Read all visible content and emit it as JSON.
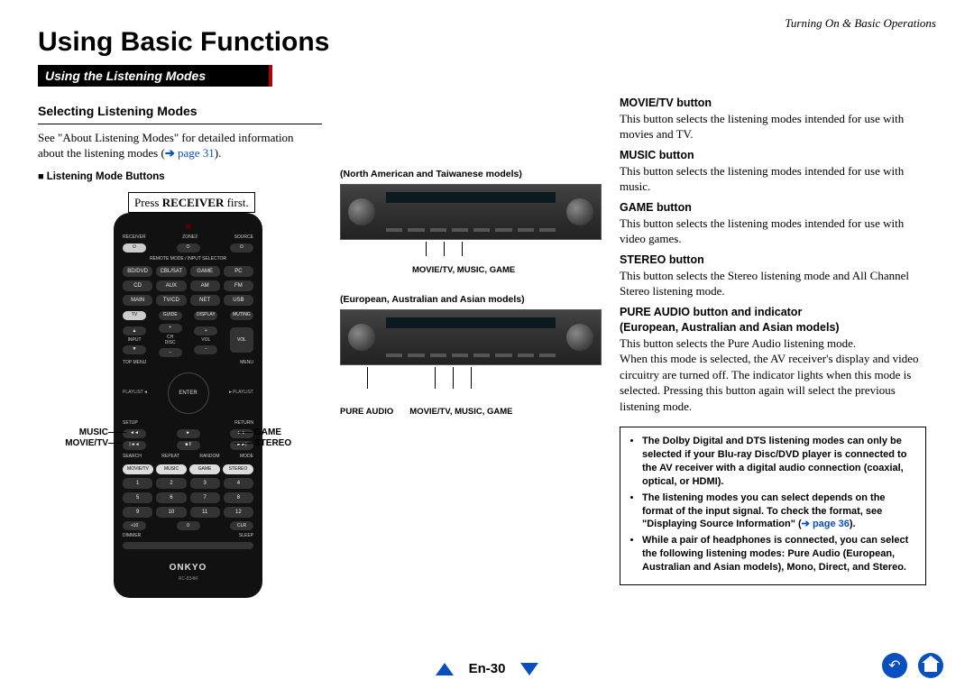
{
  "header": {
    "breadcrumb": "Turning On & Basic Operations"
  },
  "title": "Using Basic Functions",
  "section_bar": "Using the Listening Modes",
  "left": {
    "sub1": "Selecting Listening Modes",
    "body1a": "See \"About Listening Modes\" for detailed information about the listening modes (",
    "page_link1": "page 31",
    "body1b": ").",
    "sub2": "Listening Mode Buttons",
    "tip_pre": "Press ",
    "tip_bold": "RECEIVER",
    "tip_post": " first.",
    "callouts": {
      "music": "MUSIC",
      "movietv": "MOVIE/TV",
      "game": "GAME",
      "stereo": "STEREO"
    },
    "remote": {
      "top_row": [
        "RECEIVER",
        "ZONE2",
        "SOURCE"
      ],
      "sel_label": "REMOTE MODE / INPUT SELECTOR",
      "grid1": [
        "BD/DVD",
        "CBL/SAT",
        "GAME",
        "PC",
        "AUX",
        "TV/CD",
        "AM",
        "FM",
        "NET",
        "USB"
      ],
      "row_tv": [
        "TV",
        "GUIDE",
        "DISPLAY",
        "MUTING"
      ],
      "row_vol": [
        "INPUT",
        "CH",
        "VOL",
        "VOL"
      ],
      "row_menu": [
        "TOP MENU",
        "",
        "MENU"
      ],
      "enter": "ENTER",
      "row_set": [
        "SETUP",
        "",
        "RETURN"
      ],
      "lm_labels_top": [
        "SEARCH",
        "REPEAT",
        "RANDOM",
        "MODE"
      ],
      "lm_buttons": [
        "MOVIE/TV",
        "MUSIC",
        "GAME",
        "STEREO"
      ],
      "num_extra": [
        "+10",
        "0",
        "CLR"
      ],
      "dimmer": "DIMMER",
      "sleep": "SLEEP",
      "logo": "ONKYO",
      "model": "RC-834M"
    }
  },
  "mid": {
    "label1": "(North American and Taiwanese models)",
    "c1": "MOVIE/TV, MUSIC, GAME",
    "label2": "(European, Australian and Asian models)",
    "c2a": "PURE AUDIO",
    "c2b": "MOVIE/TV, MUSIC, GAME"
  },
  "right": {
    "items": [
      {
        "t": "MOVIE/TV button",
        "b": "This button selects the listening modes intended for use with movies and TV."
      },
      {
        "t": "MUSIC button",
        "b": "This button selects the listening modes intended for use with music."
      },
      {
        "t": "GAME button",
        "b": "This button selects the listening modes intended for use with video games."
      },
      {
        "t": "STEREO button",
        "b": "This button selects the Stereo listening mode and All Channel Stereo listening mode."
      }
    ],
    "pure": {
      "t1": "PURE AUDIO button and indicator",
      "t2": "(European, Australian and Asian models)",
      "b": "This button selects the Pure Audio listening mode.\nWhen this mode is selected, the AV receiver's display and video circuitry are turned off. The indicator lights when this mode is selected. Pressing this button again will select the previous listening mode."
    },
    "notes": {
      "n1": "The Dolby Digital and DTS listening modes can only be selected if your Blu-ray Disc/DVD player is connected to the AV receiver with a digital audio connection (coaxial, optical, or HDMI).",
      "n2a": "The listening modes you can select depends on the format of the input signal. To check the format, see \"Displaying Source Information\" (",
      "n2link": "page 36",
      "n2b": ").",
      "n3": "While a pair of headphones is connected, you can select the following listening modes: Pure Audio (European, Australian and Asian models), Mono, Direct, and Stereo."
    }
  },
  "footer": {
    "page": "En-30"
  }
}
